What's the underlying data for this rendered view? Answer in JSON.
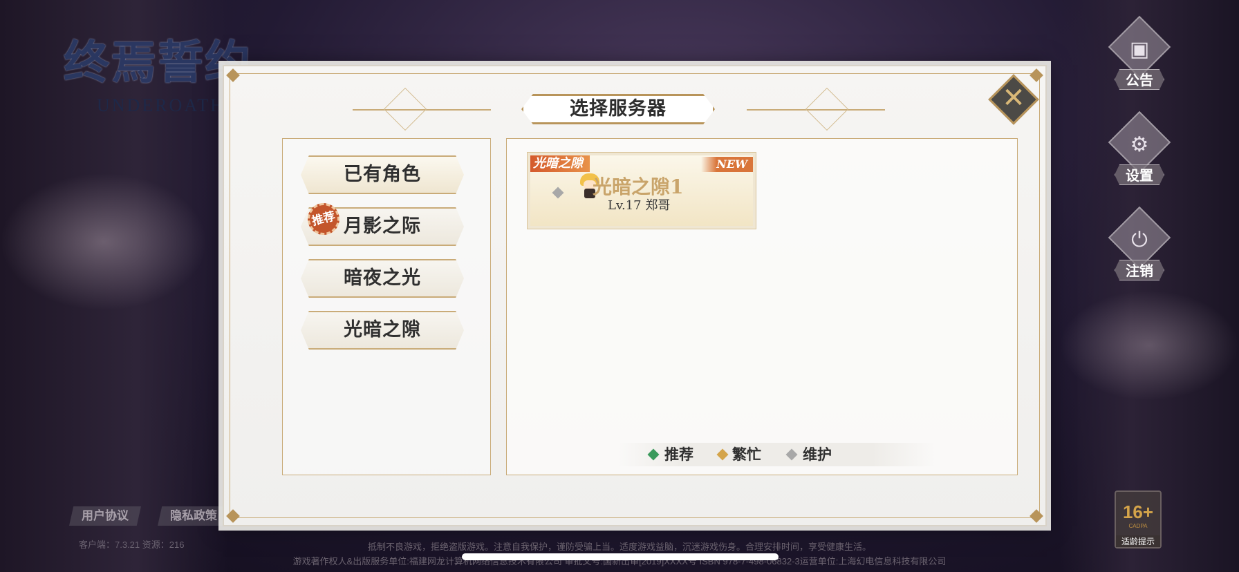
{
  "logo": {
    "cn": "终焉誓约",
    "en": "UNDEROATH"
  },
  "dialog": {
    "title": "选择服务器",
    "close_icon": "close-x-icon"
  },
  "tabs": [
    {
      "label": "已有角色",
      "active": true
    },
    {
      "label": "月影之际",
      "badge": "推荐"
    },
    {
      "label": "暗夜之光"
    },
    {
      "label": "光暗之隙"
    }
  ],
  "server_card": {
    "tag": "光暗之隙",
    "new_label": "NEW",
    "name": "光暗之隙1",
    "level": "Lv.17 郑哥",
    "status": "maintenance"
  },
  "legend": [
    {
      "label": "推荐",
      "color": "#3a9a5c"
    },
    {
      "label": "繁忙",
      "color": "#d4a44a"
    },
    {
      "label": "维护",
      "color": "#a8a8a8"
    }
  ],
  "side_menu": [
    {
      "label": "公告",
      "icon": "announcement-icon"
    },
    {
      "label": "设置",
      "icon": "gear-icon"
    },
    {
      "label": "注销",
      "icon": "power-icon"
    }
  ],
  "bottom_links": {
    "agreement": "用户协议",
    "privacy": "隐私政策"
  },
  "version": "客户端：7.3.21  资源：216",
  "notice_line1": "抵制不良游戏，拒绝盗版游戏。注意自我保护，谨防受骗上当。适度游戏益脑，沉迷游戏伤身。合理安排时间，享受健康生活。",
  "notice_line2": "游戏著作权人&出版服务单位:福建网龙计算机网络信息技术有限公司 审批文号:国新出审[2019]XXXX号 ISBN 978-7-498-06832-3运营单位:上海幻电信息科技有限公司",
  "age_rating": {
    "num": "16+",
    "sub": "CADPA",
    "tip": "适龄提示"
  }
}
